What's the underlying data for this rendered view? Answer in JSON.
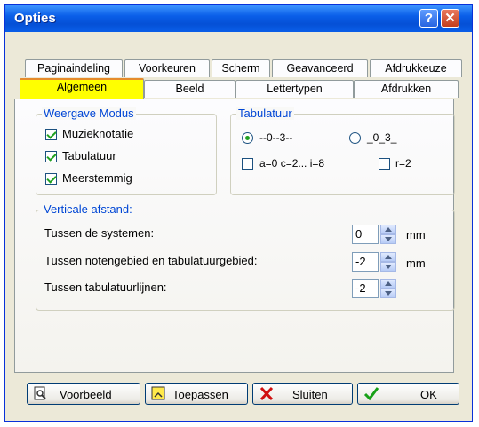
{
  "window": {
    "title": "Opties"
  },
  "tabs_back": [
    "Paginaindeling",
    "Voorkeuren",
    "Scherm",
    "Geavanceerd",
    "Afdrukkeuze"
  ],
  "tabs_front": [
    "Algemeen",
    "Beeld",
    "Lettertypen",
    "Afdrukken"
  ],
  "display_mode": {
    "legend": "Weergave Modus",
    "options": [
      {
        "label": "Muzieknotatie",
        "checked": true
      },
      {
        "label": "Tabulatuur",
        "checked": true
      },
      {
        "label": "Meerstemmig",
        "checked": true
      }
    ]
  },
  "tablature": {
    "legend": "Tabulatuur",
    "radio1": "--0--3--",
    "radio2": "_0_3_",
    "check1": "a=0 c=2... i=8",
    "check2": "r=2"
  },
  "spacing": {
    "legend": "Verticale afstand:",
    "rows": [
      {
        "label": "Tussen de systemen:",
        "value": "0",
        "unit": "mm"
      },
      {
        "label": "Tussen notengebied en tabulatuurgebied:",
        "value": "-2",
        "unit": "mm"
      },
      {
        "label": "Tussen tabulatuurlijnen:",
        "value": "-2",
        "unit": ""
      }
    ]
  },
  "buttons": {
    "preview": "Voorbeeld",
    "apply": "Toepassen",
    "close": "Sluiten",
    "ok": "OK"
  },
  "colors": {
    "active_tab": "#ffff00",
    "legend": "#0046d5",
    "titlebar": "#0a5ee8"
  }
}
